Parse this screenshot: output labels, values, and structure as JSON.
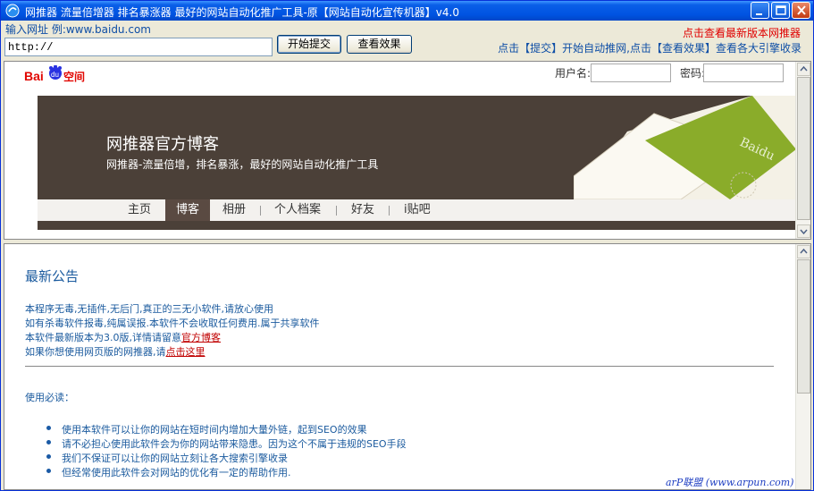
{
  "window": {
    "title": "网推器 流量倍增器 排名暴涨器 最好的网站自动化推广工具-原【网站自动化宣传机器】v4.0"
  },
  "toolbar": {
    "url_label": "输入网址 例:www.baidu.com",
    "url_value": "http://",
    "submit_label": "开始提交",
    "view_label": "查看效果",
    "latest_link": "点击查看最新版本网推器",
    "hint": "点击【提交】开始自动推网,点击【查看效果】查看各大引擎收录"
  },
  "blog_header": {
    "logo_text": "Bai du 空间",
    "username_label": "用户名:",
    "password_label": "密码:",
    "banner_title": "网推器官方博客",
    "banner_subtitle": "网推器-流量倍增，排名暴涨，最好的网站自动化推广工具",
    "nav": [
      {
        "label": "主页"
      },
      {
        "label": "博客"
      },
      {
        "label": "相册"
      },
      {
        "label": "个人档案"
      },
      {
        "label": "好友"
      },
      {
        "label": "i贴吧"
      }
    ]
  },
  "notice": {
    "title": "最新公告",
    "lines": [
      "本程序无毒,无插件,无后门,真正的三无小软件,请放心使用",
      "如有杀毒软件报毒,纯属误报.本软件不会收取任何费用.属于共享软件"
    ],
    "line3_prefix": "本软件最新版本为3.0版,详情请留意",
    "line3_link": "官方博客",
    "line4_prefix": "如果你想使用网页版的网推器,请",
    "line4_link": "点击这里",
    "must_read_title": "使用必读：",
    "bullets": [
      "使用本软件可以让你的网站在短时间内增加大量外链，起到SEO的效果",
      "请不必担心使用此软件会为你的网站带来隐患。因为这个不属于违规的SEO手段",
      "我们不保证可以让你的网站立刻让各大搜索引擎收录",
      "但经常使用此软件会对网站的优化有一定的帮助作用."
    ]
  },
  "watermark": "arP联盟 (www.arpun.com)",
  "colors": {
    "titlebar": "#0053e1",
    "banner_bg": "#4b4038",
    "notice_text": "#1a5a9e",
    "link_red": "#e00000"
  }
}
